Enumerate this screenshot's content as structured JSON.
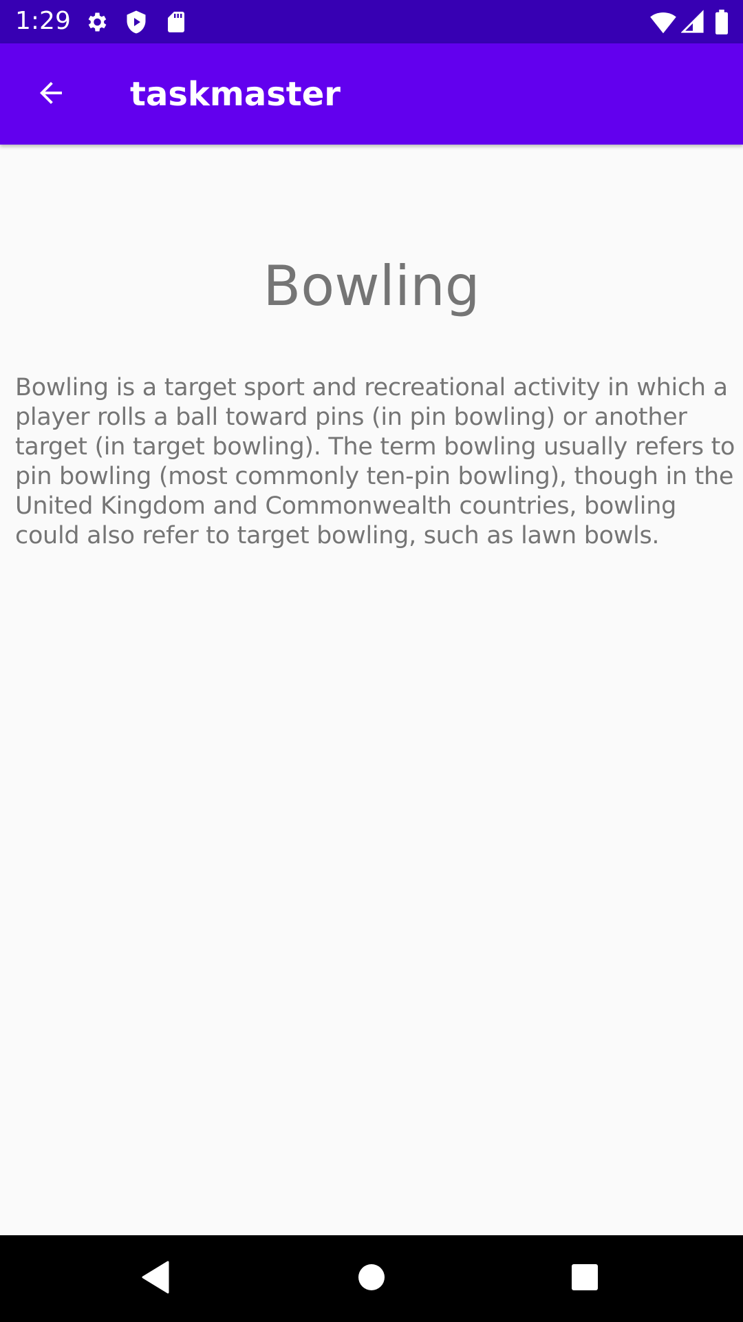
{
  "status_bar": {
    "time": "1:29",
    "icons": [
      "settings-icon",
      "shield-play-icon",
      "sd-card-icon",
      "wifi-icon",
      "signal-icon",
      "battery-icon"
    ],
    "background": "#3700b3"
  },
  "app_bar": {
    "title": "taskmaster",
    "back_icon": "arrow-back-icon",
    "background": "#6200ee"
  },
  "content": {
    "title": "Bowling",
    "body": "Bowling is a target sport and recreational activity in which a player rolls a ball toward pins (in pin bowling) or another target (in target bowling). The term bowling usually refers to pin bowling (most commonly ten-pin bowling), though in the United Kingdom and Commonwealth countries, bowling could also refer to target bowling, such as lawn bowls."
  },
  "nav_bar": {
    "buttons": [
      "back-triangle-icon",
      "home-circle-icon",
      "recents-square-icon"
    ]
  }
}
